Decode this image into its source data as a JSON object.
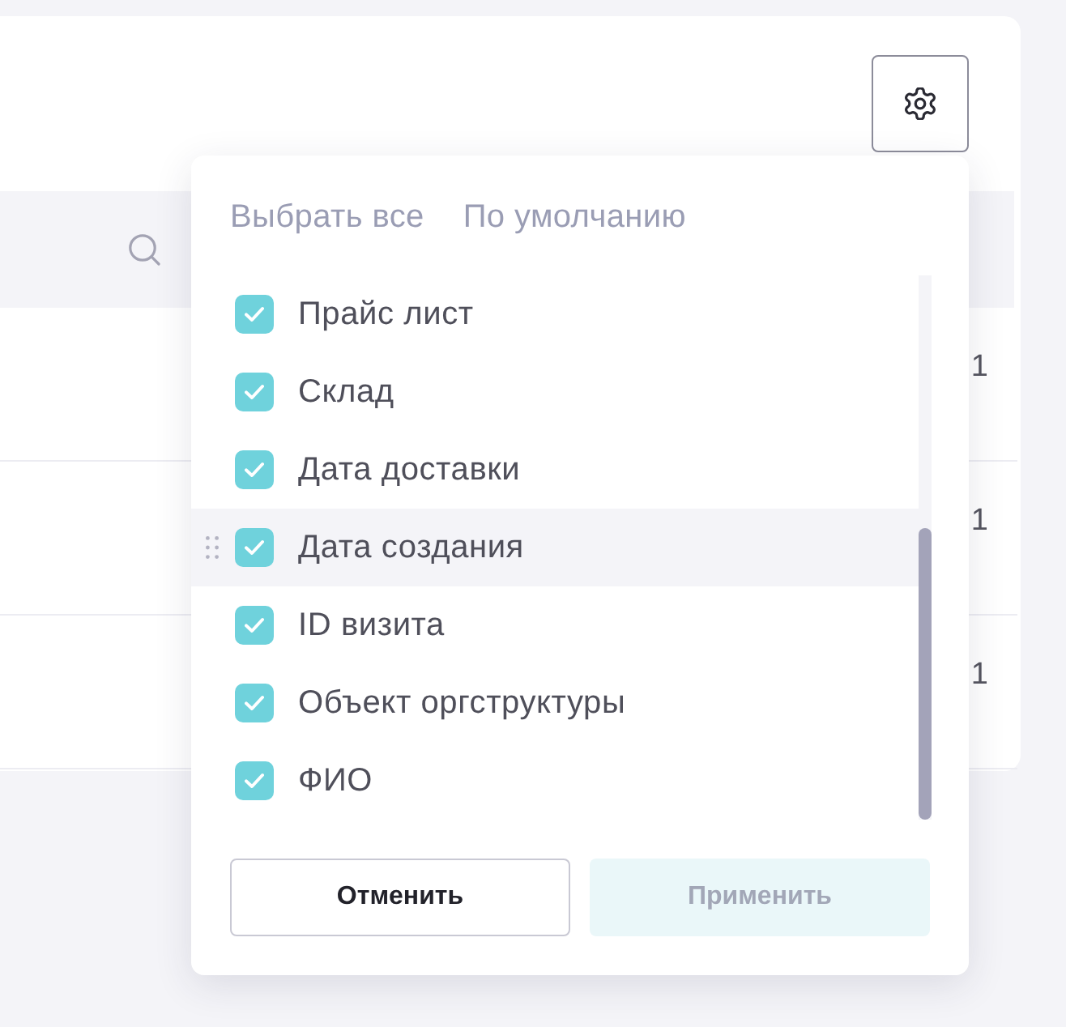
{
  "table": {
    "rows": [
      {
        "cell": "1"
      },
      {
        "cell": "1"
      },
      {
        "cell": "1"
      }
    ]
  },
  "column_menu": {
    "actions": [
      {
        "label": "Выбрать все",
        "disabled": true
      },
      {
        "label": "По умолчанию",
        "disabled": true
      }
    ],
    "items": [
      {
        "label": "Прайс лист",
        "checked": true,
        "hovered": false
      },
      {
        "label": "Склад",
        "checked": true,
        "hovered": false
      },
      {
        "label": "Дата доставки",
        "checked": true,
        "hovered": false
      },
      {
        "label": "Дата создания",
        "checked": true,
        "hovered": true
      },
      {
        "label": "ID визита",
        "checked": true,
        "hovered": false
      },
      {
        "label": "Объект оргструктуры",
        "checked": true,
        "hovered": false
      },
      {
        "label": "ФИО",
        "checked": true,
        "hovered": false
      }
    ],
    "buttons": [
      {
        "label": "Отменить",
        "kind": "secondary",
        "disabled": false
      },
      {
        "label": "Применить",
        "kind": "primary",
        "disabled": true
      }
    ]
  }
}
